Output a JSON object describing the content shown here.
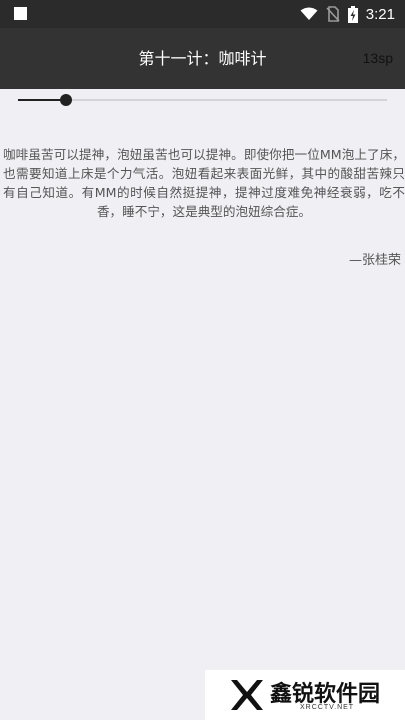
{
  "status_bar": {
    "time": "3:21",
    "icons": [
      "notification-square-icon",
      "wifi-icon",
      "no-sim-icon",
      "battery-charging-icon"
    ]
  },
  "app_bar": {
    "title": "第十一计：咖啡计",
    "font_size_label": "13sp"
  },
  "slider": {
    "value_fraction": 0.13
  },
  "content": {
    "text": "咖啡虽苦可以提神，泡妞虽苦也可以提神。即使你把一位MM泡上了床，也需要知道上床是个力气活。泡妞看起来表面光鲜，其中的酸甜苦辣只有自己知道。有MM的时候自然挺提神，提神过度难免神经衰弱，吃不香，睡不宁，这是典型的泡妞综合症。",
    "author": "—张桂荣"
  },
  "watermark": {
    "title": "鑫锐软件园",
    "subtitle": "XRCCTV.NET"
  },
  "colors": {
    "status_bar": "#2b2b2b",
    "app_bar": "#333333",
    "background": "#efeff4"
  }
}
